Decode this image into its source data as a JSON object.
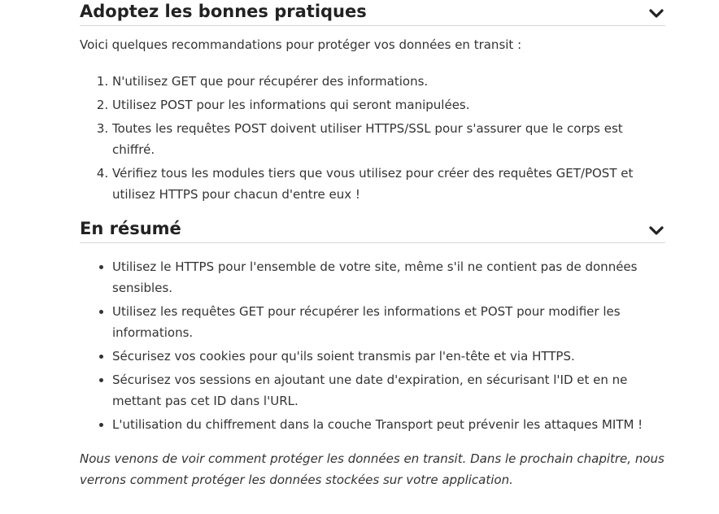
{
  "sections": [
    {
      "title": "Adoptez les bonnes pratiques",
      "intro": "Voici quelques recommandations pour protéger vos données en transit :",
      "items": [
        "N'utilisez GET que pour récupérer des informations.",
        "Utilisez POST pour les informations qui seront manipulées.",
        "Toutes les requêtes POST doivent utiliser HTTPS/SSL pour s'assurer que le corps est chiffré.",
        "Vérifiez tous les modules tiers que vous utilisez pour créer des requêtes GET/POST et utilisez HTTPS pour chacun d'entre eux !"
      ]
    },
    {
      "title": "En résumé",
      "items": [
        "Utilisez le HTTPS pour l'ensemble de votre site, même s'il ne contient pas de données sensibles.",
        "Utilisez les requêtes GET pour récupérer les informations et POST pour modifier les informations.",
        "Sécurisez vos cookies pour qu'ils soient transmis par l'en-tête et via HTTPS.",
        "Sécurisez vos sessions en ajoutant une date d'expiration, en sécurisant l'ID et en ne mettant pas cet ID dans l'URL.",
        "L'utilisation du chiffrement dans la couche Transport peut prévenir les attaques MITM !"
      ]
    }
  ],
  "outro": "Nous venons de voir comment protéger les données en transit. Dans le prochain chapitre, nous verrons comment protéger les données stockées sur votre application.",
  "icons": {
    "toggle": "chevron-down-icon"
  },
  "colors": {
    "text": "#333333",
    "heading": "#222222",
    "divider": "#d6d6d6"
  }
}
